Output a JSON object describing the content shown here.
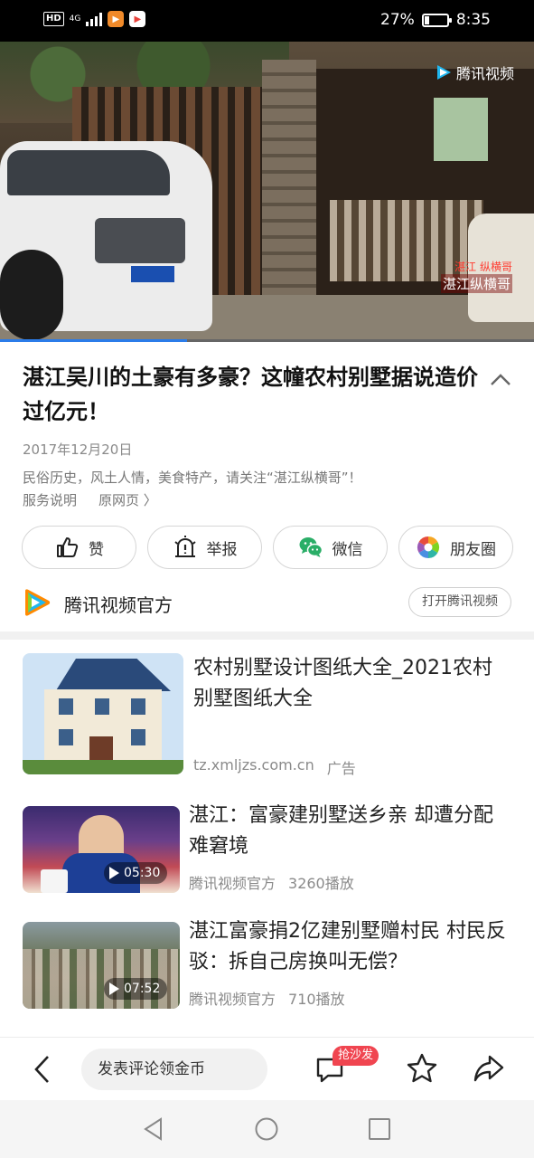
{
  "status_bar": {
    "network": "HD",
    "network_type": "4G",
    "battery": "27%",
    "battery_level": 0.27,
    "time": "8:35"
  },
  "video": {
    "logo_text": "腾讯视频",
    "watermark": "湛江纵横哥",
    "watermark_small": "湛江 纵横哥",
    "progress": 0.35
  },
  "article": {
    "title": "湛江吴川的土豪有多豪？这幢农村别墅据说造价过亿元！",
    "date": "2017年12月20日",
    "description": "民俗历史，风土人情，美食特产，请关注“湛江纵横哥”！",
    "service_link": "服务说明",
    "source_page_link": "原网页 〉"
  },
  "actions": [
    {
      "label": "赞",
      "icon": "thumbs-up-icon"
    },
    {
      "label": "举报",
      "icon": "report-icon"
    },
    {
      "label": "微信",
      "icon": "wechat-icon"
    },
    {
      "label": "朋友圈",
      "icon": "moments-icon"
    }
  ],
  "source": {
    "name": "腾讯视频官方",
    "open_button": "打开腾讯视频"
  },
  "feed": {
    "ad": {
      "title": "农村别墅设计图纸大全_2021农村别墅图纸大全",
      "domain": "tz.xmljzs.com.cn",
      "tag": "广告"
    },
    "items": [
      {
        "title": "湛江：富豪建别墅送乡亲 却遭分配难窘境",
        "source": "腾讯视频官方",
        "plays": "3260播放",
        "duration": "05:30"
      },
      {
        "title": "湛江富豪捐2亿建别墅赠村民 村民反驳：拆自己房换叫无偿？",
        "source": "腾讯视频官方",
        "plays": "710播放",
        "duration": "07:52"
      }
    ]
  },
  "toolbar": {
    "comment_placeholder": "发表评论领金币",
    "badge": "抢沙发"
  },
  "colors": {
    "accent": "#2b7ce9",
    "badge": "#f04550",
    "wechat_green": "#2aae67"
  }
}
